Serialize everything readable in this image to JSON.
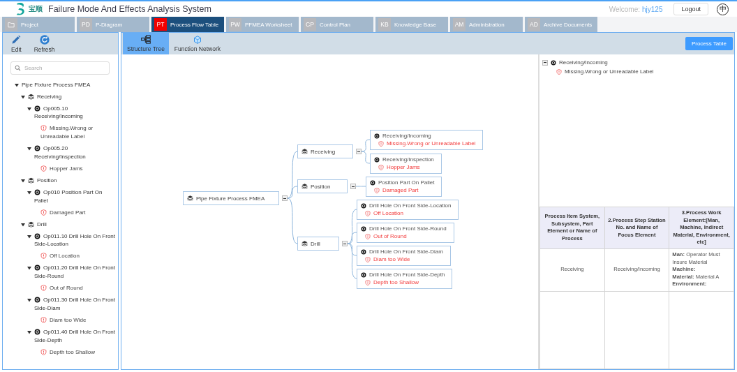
{
  "header": {
    "logo_text": "宝顺",
    "title": "Failure Mode And Effects Analysis System",
    "welcome_label": "Welcome:",
    "username": "hjy125",
    "logout": "Logout",
    "language": "中"
  },
  "tabs": [
    {
      "kind": "icon",
      "label": "Project",
      "selected": false
    },
    {
      "kind": "code",
      "code": "PD",
      "label": "P-Diagram",
      "selected": false
    },
    {
      "kind": "code",
      "code": "PT",
      "label": "Process Flow Table",
      "selected": true
    },
    {
      "kind": "code",
      "code": "PW",
      "label": "PFMEA Worksheet",
      "selected": false
    },
    {
      "kind": "code",
      "code": "CP",
      "label": "Control Plan",
      "selected": false
    },
    {
      "kind": "code",
      "code": "KB",
      "label": "Knowledge Base",
      "selected": false
    },
    {
      "kind": "code",
      "code": "AM",
      "label": "Administration",
      "selected": false
    },
    {
      "kind": "code",
      "code": "AD",
      "label": "Archive Documents",
      "selected": false
    }
  ],
  "sidebar": {
    "tools": [
      {
        "kind": "edit",
        "label": "Edit"
      },
      {
        "kind": "refresh",
        "label": "Refresh"
      }
    ],
    "search": {
      "placeholder": "Search"
    },
    "tree": [
      {
        "kind": "process",
        "label": "Pipe Fixture Process FMEA",
        "expanded": true,
        "children": [
          {
            "kind": "group",
            "label": "Receiving",
            "expanded": true,
            "children": [
              {
                "kind": "operation",
                "label": "Op005.10 Receiving/Incoming",
                "expanded": true,
                "children": [
                  {
                    "kind": "failure",
                    "label": "Missing.Wrong or Unreadable Label"
                  }
                ]
              },
              {
                "kind": "operation",
                "label": "Op005.20 Receiving/Inspection",
                "expanded": true,
                "children": [
                  {
                    "kind": "failure",
                    "label": "Hopper Jams"
                  }
                ]
              }
            ]
          },
          {
            "kind": "group",
            "label": "Position",
            "expanded": true,
            "children": [
              {
                "kind": "operation",
                "label": "Op010 Position Part On Pallet",
                "expanded": true,
                "children": [
                  {
                    "kind": "failure",
                    "label": "Damaged Part"
                  }
                ]
              }
            ]
          },
          {
            "kind": "group",
            "label": "Drill",
            "expanded": true,
            "children": [
              {
                "kind": "operation",
                "label": "Op011.10 Drill Hole On Front Side-Location",
                "expanded": true,
                "children": [
                  {
                    "kind": "failure",
                    "label": "Off Location"
                  }
                ]
              },
              {
                "kind": "operation",
                "label": "Op011.20 Drill Hole On Front Side-Round",
                "expanded": true,
                "children": [
                  {
                    "kind": "failure",
                    "label": "Out of Round"
                  }
                ]
              },
              {
                "kind": "operation",
                "label": "Op011.30 Drill Hole On Front Side-Diam",
                "expanded": true,
                "children": [
                  {
                    "kind": "failure",
                    "label": "Diam too Wide"
                  }
                ]
              },
              {
                "kind": "operation",
                "label": "Op011.40 Drill Hole On Front Side-Depth",
                "expanded": true,
                "children": [
                  {
                    "kind": "failure",
                    "label": "Depth too Shallow"
                  }
                ]
              }
            ]
          }
        ]
      }
    ]
  },
  "workspace": {
    "view_tabs": [
      {
        "kind": "tree",
        "label": "Structure Tree",
        "selected": true
      },
      {
        "kind": "network",
        "label": "Function Network",
        "selected": false
      }
    ],
    "process_table_button": "Process Table",
    "diagram": {
      "root": {
        "label": "Pipe Fixture Process FMEA",
        "expanded": true,
        "children": [
          {
            "label": "Receiving",
            "expanded": true,
            "children": [
              {
                "step": "Receiving/Incoming",
                "failure": "Missing.Wrong or Unreadable Label"
              },
              {
                "step": "Receiving/Inspection",
                "failure": "Hopper Jams"
              }
            ]
          },
          {
            "label": "Position",
            "expanded": true,
            "children": [
              {
                "step": "Position Part On Pallet",
                "failure": "Damaged Part"
              }
            ]
          },
          {
            "label": "Drill",
            "expanded": true,
            "children": [
              {
                "step": "Drill Hole On Front Side-Location",
                "failure": "Off Location"
              },
              {
                "step": "Drill Hole On Front Side-Round",
                "failure": "Out of Round"
              },
              {
                "step": "Drill Hole On Front Side-Diam",
                "failure": "Diam too Wide"
              },
              {
                "step": "Drill Hole On Front Side-Depth",
                "failure": "Depth too Shallow"
              }
            ]
          }
        ]
      }
    },
    "detail": {
      "tree": [
        {
          "label": "Receiving/Incoming",
          "expanded": true,
          "failures": [
            "Missing.Wrong or Unreadable Label"
          ]
        }
      ],
      "table": {
        "columns": [
          "Process Item System, Subsystem, Part Element or Name of Process",
          "2.Process Step Station No. and Name of Focus Element",
          "3.Process Work Element:[Man, Machine, Indirect Material, Environment, etc]"
        ],
        "rows": [
          {
            "item": "Receiving",
            "step": "Receiving/Incoming",
            "work_element": [
              "**Man:** Operator Must Insure Material",
              "**Machine:**",
              "**Material:** Material A",
              "**Environment:**"
            ]
          }
        ]
      }
    }
  }
}
